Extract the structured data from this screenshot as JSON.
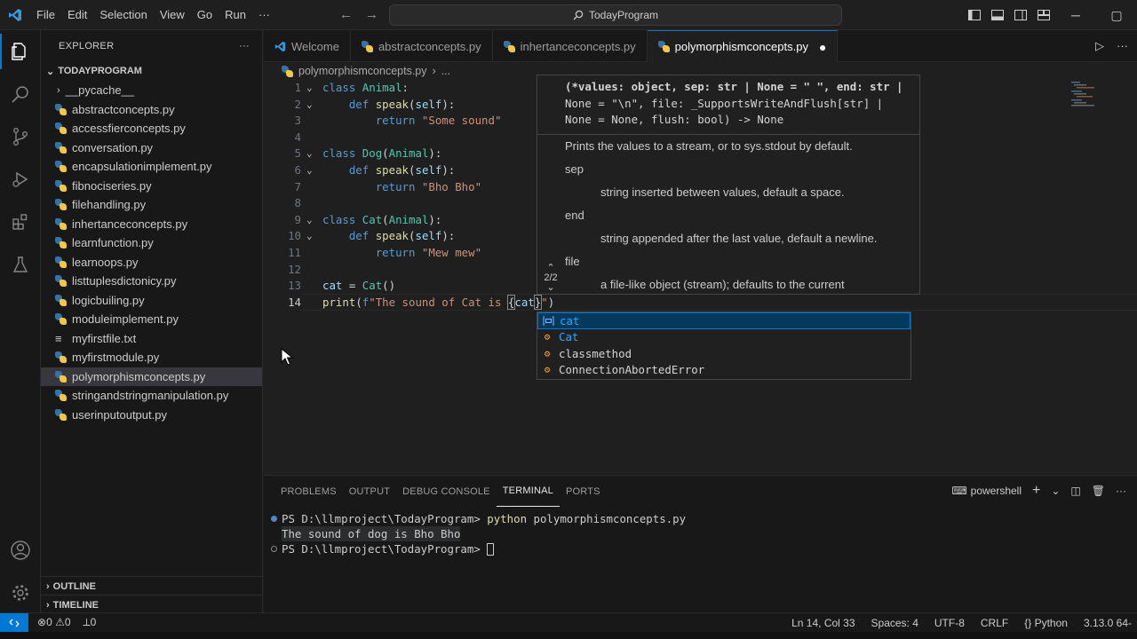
{
  "titlebar": {
    "menu": [
      "File",
      "Edit",
      "Selection",
      "View",
      "Go",
      "Run",
      "···"
    ],
    "search_text": "TodayProgram"
  },
  "sidebar": {
    "title": "EXPLORER",
    "more": "···",
    "folder": "TODAYPROGRAM",
    "pycache": "__pycache__",
    "files": [
      "abstractconcepts.py",
      "accessfierconcepts.py",
      "conversation.py",
      "encapsulationimplement.py",
      "fibnociseries.py",
      "filehandling.py",
      "inhertanceconcepts.py",
      "learnfunction.py",
      "learnoops.py",
      "listtuplesdictonicy.py",
      "logicbuiling.py",
      "moduleimplement.py",
      "myfirstfile.txt",
      "myfirstmodule.py",
      "polymorphismconcepts.py",
      "stringandstringmanipulation.py",
      "userinputoutput.py"
    ],
    "selected_index": 14,
    "outline": "OUTLINE",
    "timeline": "TIMELINE"
  },
  "tabs": [
    "Welcome",
    "abstractconcepts.py",
    "inhertanceconcepts.py",
    "polymorphismconcepts.py"
  ],
  "active_tab": 3,
  "breadcrumb": {
    "file": "polymorphismconcepts.py",
    "more": "..."
  },
  "editor": {
    "lines": [
      "1",
      "2",
      "3",
      "4",
      "5",
      "6",
      "7",
      "8",
      "9",
      "10",
      "11",
      "12",
      "13",
      "14"
    ],
    "current_line": 14
  },
  "hover": {
    "sig1": "(*values: object, sep: str | None = \" \", end: str |",
    "sig2": "None = \"\\n\", file: _SupportsWriteAndFlush[str] |",
    "sig3": "None = None, flush: bool) -> None",
    "desc": "Prints the values to a stream, or to sys.stdout by default.",
    "sep": "sep",
    "sep_desc": "string inserted between values, default a space.",
    "end": "end",
    "end_desc": "string appended after the last value, default a newline.",
    "file": "file",
    "file_desc": "a file-like object (stream); defaults to the current",
    "count": "2/2"
  },
  "suggest": {
    "items": [
      {
        "label": "cat",
        "kind": "variable"
      },
      {
        "label": "Cat",
        "kind": "class"
      },
      {
        "label": "classmethod",
        "kind": "class"
      },
      {
        "label": "ConnectionAbortedError",
        "kind": "class"
      }
    ],
    "selected_index": 0
  },
  "panel": {
    "tabs": [
      "PROBLEMS",
      "OUTPUT",
      "DEBUG CONSOLE",
      "TERMINAL",
      "PORTS"
    ],
    "active_tab": 3,
    "shell": "powershell",
    "line1_prompt": "PS D:\\llmproject\\TodayProgram> ",
    "line1_cmd": "python",
    "line1_arg": " polymorphismconcepts.py",
    "line2": "The sound of dog is Bho Bho",
    "line3_prompt": "PS D:\\llmproject\\TodayProgram> "
  },
  "status": {
    "errors": "0",
    "warnings": "0",
    "ports": "0",
    "position": "Ln 14, Col 33",
    "spaces": "Spaces: 4",
    "encoding": "UTF-8",
    "eol": "CRLF",
    "lang": "Python",
    "version": "3.13.0 64-"
  },
  "colors": {
    "accent": "#0078d4",
    "keyword": "#569cd6",
    "class": "#4ec9b0",
    "function": "#dcdcaa",
    "string": "#ce9178"
  }
}
